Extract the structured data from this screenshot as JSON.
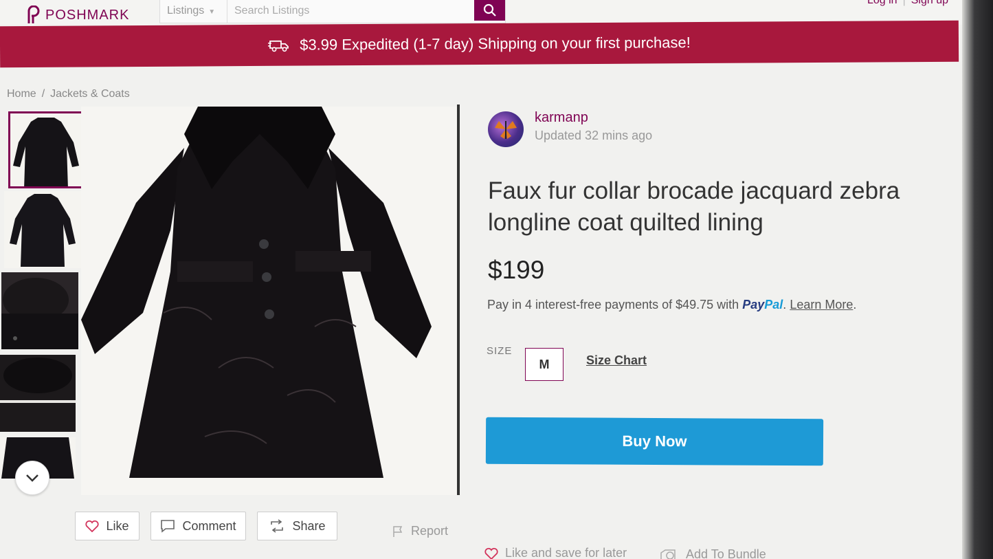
{
  "header": {
    "logo_text": "POSHMARK",
    "search": {
      "category": "Listings",
      "placeholder": "Search Listings"
    },
    "login_label": "Log in",
    "signup_label": "Sign up"
  },
  "banner": {
    "text": "$3.99 Expedited (1-7 day) Shipping on your first purchase!"
  },
  "breadcrumb": {
    "home": "Home",
    "separator": "/",
    "category": "Jackets & Coats"
  },
  "seller": {
    "username": "karmanp",
    "updated": "Updated 32 mins ago"
  },
  "listing": {
    "title": "Faux fur collar brocade jacquard zebra longline coat quilted lining",
    "price": "$199",
    "paypal": {
      "prefix": "Pay in 4 interest-free payments of $49.75 with",
      "logo_pay": "Pay",
      "logo_pal": "Pal",
      "learn_more": "Learn More",
      "suffix": "."
    },
    "size_label": "SIZE",
    "size_value": "M",
    "size_chart": "Size Chart",
    "buy_now": "Buy Now"
  },
  "actions": {
    "like": "Like",
    "comment": "Comment",
    "share": "Share",
    "report": "Report",
    "like_save": "Like and save for later",
    "add_bundle": "Add To Bundle"
  },
  "colors": {
    "brand": "#7f0353",
    "banner": "#a8183d",
    "buy_now": "#1e9ad6"
  }
}
